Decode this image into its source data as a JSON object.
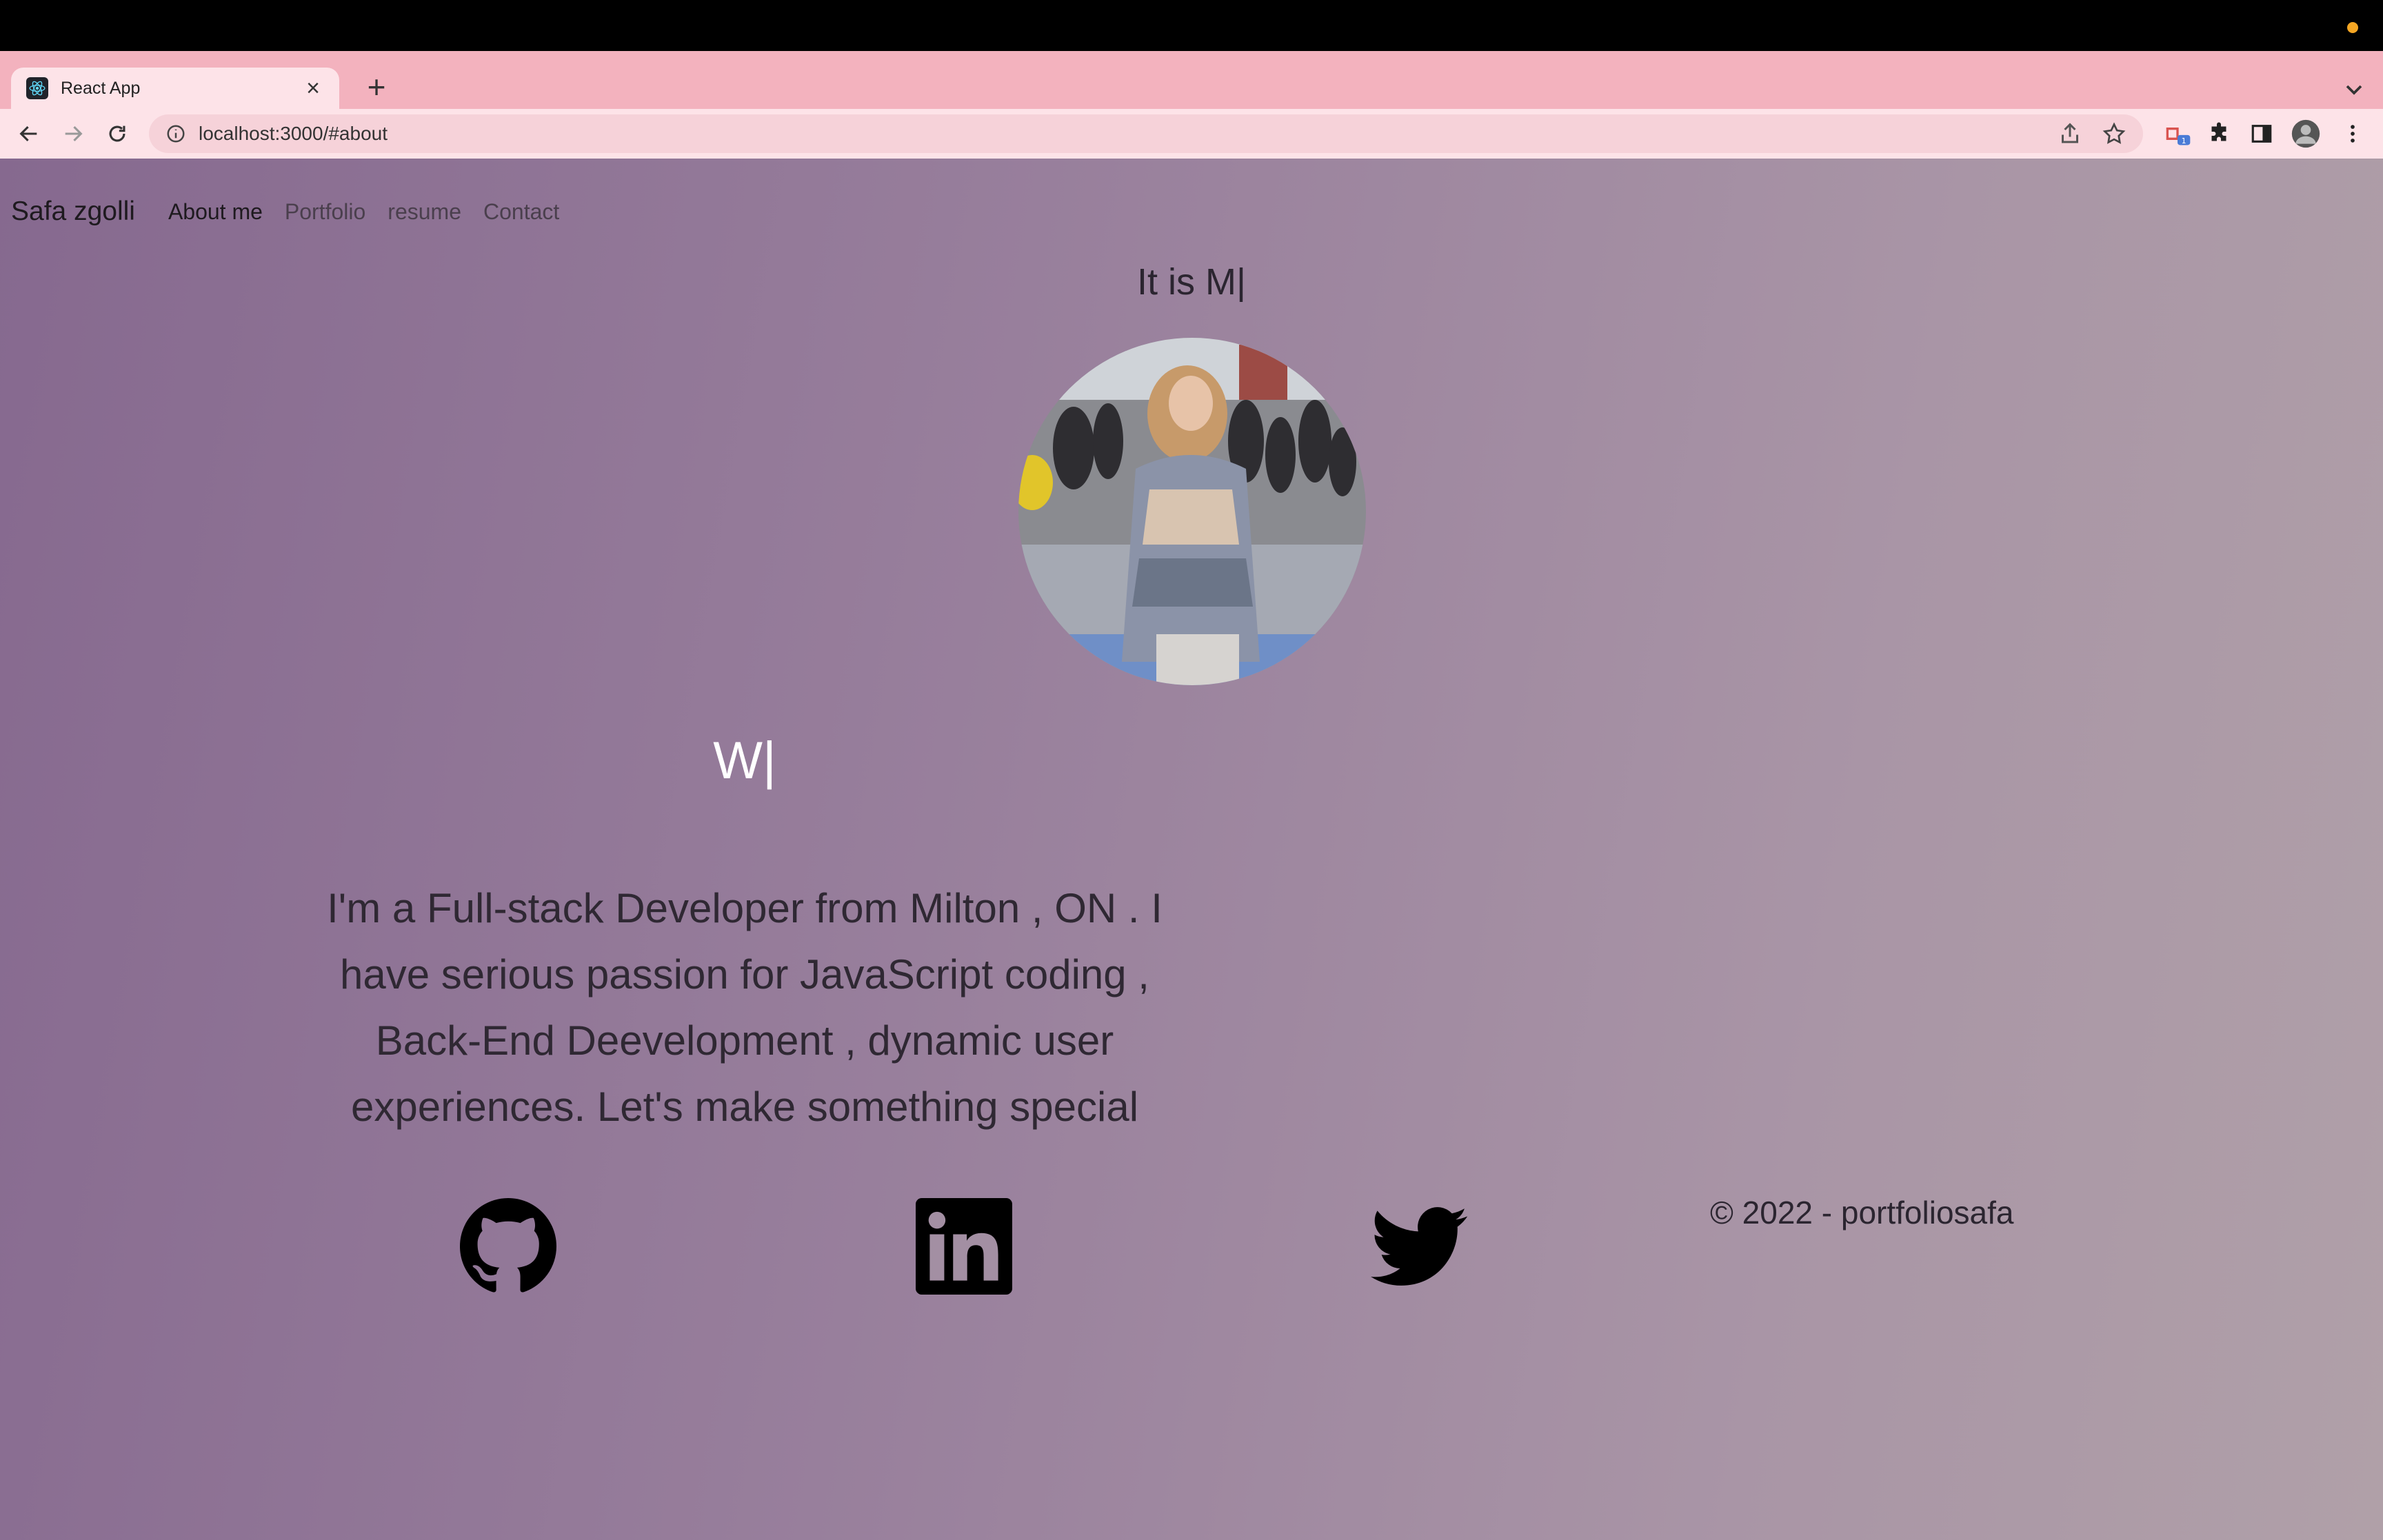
{
  "browser": {
    "tab_title": "React App",
    "new_tab_symbol": "+",
    "close_symbol": "×",
    "url": "localhost:3000/#about",
    "extension_badge": "1",
    "icons": [
      "react-favicon",
      "back-arrow-icon",
      "forward-arrow-icon",
      "reload-icon",
      "info-icon",
      "share-icon",
      "star-icon",
      "extension-icon",
      "puzzle-icon",
      "sidepanel-icon",
      "profile-avatar",
      "kebab-menu-icon",
      "tab-list-chevron-icon"
    ]
  },
  "nav": {
    "brand": "Safa zgolli",
    "links": [
      "About me",
      "Portfolio",
      "resume",
      "Contact"
    ],
    "active": "About me"
  },
  "hero": {
    "greeting": "It is M|",
    "typing": "W|",
    "bio": "I'm a Full-stack Developer from Milton , ON . I have serious passion for JavaScript coding , Back-End Deevelopment , dynamic user experiences. Let's make something special"
  },
  "footer": {
    "social_icons": [
      "github-icon",
      "linkedin-icon",
      "twitter-icon"
    ],
    "copyright": "© 2022 - portfoliosafa"
  },
  "colors": {
    "tabstrip": "#f3b2be",
    "toolbar": "#fde3e8",
    "gradient_start": "#86698f",
    "gradient_end": "#b0a0a8"
  }
}
